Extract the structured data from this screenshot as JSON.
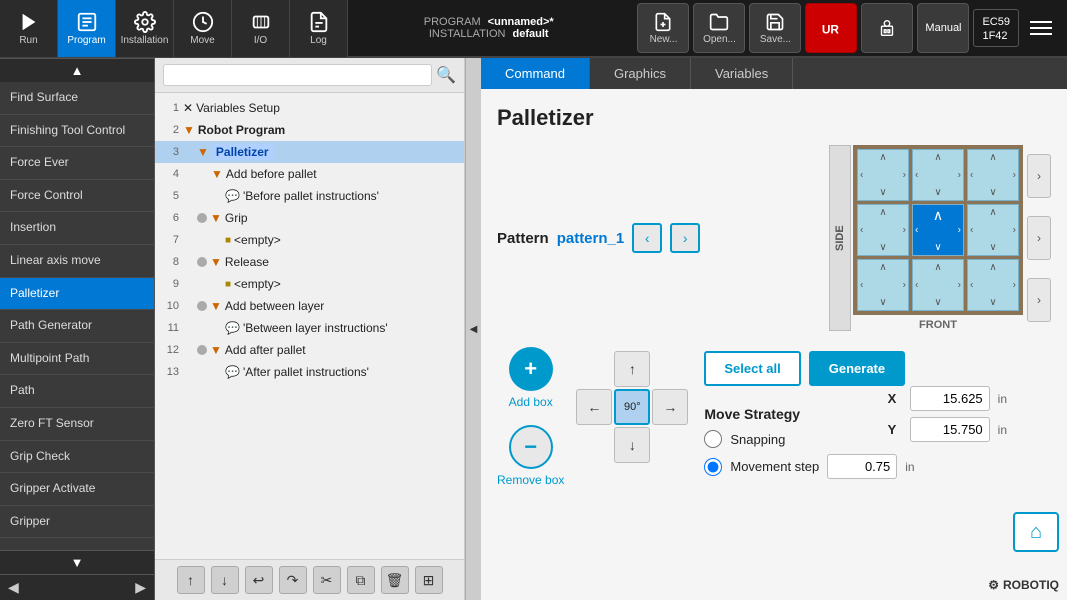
{
  "topbar": {
    "run_label": "Run",
    "program_label": "Program",
    "installation_label": "Installation",
    "move_label": "Move",
    "io_label": "I/O",
    "log_label": "Log",
    "program_name_label": "PROGRAM",
    "program_name_value": "<unnamed>*",
    "installation_name_label": "INSTALLATION",
    "installation_name_value": "default",
    "new_label": "New...",
    "open_label": "Open...",
    "save_label": "Save...",
    "manual_label": "Manual",
    "ec_label": "EC59\n1F42"
  },
  "sidebar": {
    "items": [
      {
        "label": "Find Surface",
        "active": false
      },
      {
        "label": "Finishing Tool Control",
        "active": false
      },
      {
        "label": "Force Ever",
        "active": false
      },
      {
        "label": "Force Control",
        "active": false
      },
      {
        "label": "Insertion",
        "active": false
      },
      {
        "label": "Linear axis move",
        "active": false
      },
      {
        "label": "Palletizer",
        "active": true
      },
      {
        "label": "Path Generator",
        "active": false
      },
      {
        "label": "Multipoint Path",
        "active": false
      },
      {
        "label": "Path",
        "active": false
      },
      {
        "label": "Zero FT Sensor",
        "active": false
      },
      {
        "label": "Grip Check",
        "active": false
      },
      {
        "label": "Gripper Activate",
        "active": false
      },
      {
        "label": "Gripper",
        "active": false
      }
    ]
  },
  "tree": {
    "search_placeholder": "",
    "rows": [
      {
        "num": "1",
        "indent": 0,
        "icon": "✕",
        "label": "Variables Setup",
        "bold": false,
        "highlight": false
      },
      {
        "num": "2",
        "indent": 0,
        "icon": "▼",
        "label": "Robot Program",
        "bold": true,
        "highlight": false
      },
      {
        "num": "3",
        "indent": 1,
        "icon": "▼",
        "label": "Palletizer",
        "bold": false,
        "highlight": true
      },
      {
        "num": "4",
        "indent": 2,
        "icon": "▼",
        "label": "Add before pallet",
        "bold": false,
        "highlight": false
      },
      {
        "num": "5",
        "indent": 3,
        "icon": "💬",
        "label": "'Before pallet instructions'",
        "bold": false,
        "highlight": false
      },
      {
        "num": "6",
        "indent": 2,
        "icon": "▼",
        "label": "Grip",
        "bold": false,
        "highlight": false
      },
      {
        "num": "7",
        "indent": 3,
        "icon": "■",
        "label": "<empty>",
        "bold": false,
        "highlight": false
      },
      {
        "num": "8",
        "indent": 2,
        "icon": "▼",
        "label": "Release",
        "bold": false,
        "highlight": false
      },
      {
        "num": "9",
        "indent": 3,
        "icon": "■",
        "label": "<empty>",
        "bold": false,
        "highlight": false
      },
      {
        "num": "10",
        "indent": 2,
        "icon": "▼",
        "label": "Add between layer",
        "bold": false,
        "highlight": false
      },
      {
        "num": "11",
        "indent": 3,
        "icon": "💬",
        "label": "'Between layer instructions'",
        "bold": false,
        "highlight": false
      },
      {
        "num": "12",
        "indent": 2,
        "icon": "▼",
        "label": "Add after pallet",
        "bold": false,
        "highlight": false
      },
      {
        "num": "13",
        "indent": 3,
        "icon": "💬",
        "label": "'After pallet instructions'",
        "bold": false,
        "highlight": false
      }
    ],
    "tools": [
      "↑",
      "↓",
      "↩",
      "↷",
      "✂",
      "⧉",
      "🗑",
      "▦"
    ]
  },
  "tabs": [
    {
      "label": "Command",
      "active": true
    },
    {
      "label": "Graphics",
      "active": false
    },
    {
      "label": "Variables",
      "active": false
    }
  ],
  "palletizer": {
    "title": "Palletizer",
    "pattern_label": "Pattern",
    "pattern_value": "pattern_1",
    "add_box_label": "Add box",
    "remove_box_label": "Remove box",
    "select_all_label": "Select all",
    "generate_label": "Generate",
    "move_strategy_label": "Move Strategy",
    "snapping_label": "Snapping",
    "movement_step_label": "Movement step",
    "movement_step_value": "0.75",
    "movement_step_unit": "in",
    "x_label": "X",
    "x_value": "15.625",
    "x_unit": "in",
    "y_label": "Y",
    "y_value": "15.750",
    "y_unit": "in",
    "front_label": "FRONT",
    "side_label": "SIDE",
    "rotation_label": "90",
    "grid": [
      {
        "row": 0,
        "col": 0,
        "arrow": "◁",
        "selected": false
      },
      {
        "row": 0,
        "col": 1,
        "arrow": "△",
        "selected": false
      },
      {
        "row": 0,
        "col": 2,
        "arrow": "▷",
        "selected": false
      },
      {
        "row": 1,
        "col": 0,
        "arrow": "◁",
        "selected": false
      },
      {
        "row": 1,
        "col": 1,
        "arrow": "△",
        "selected": true
      },
      {
        "row": 1,
        "col": 2,
        "arrow": "▷",
        "selected": false
      },
      {
        "row": 2,
        "col": 0,
        "arrow": "◁",
        "selected": false
      },
      {
        "row": 2,
        "col": 1,
        "arrow": "▽",
        "selected": false
      },
      {
        "row": 2,
        "col": 2,
        "arrow": "▷",
        "selected": false
      }
    ]
  },
  "robotiq": {
    "logo_symbol": "⚙",
    "logo_text": "ROBOTIQ"
  }
}
